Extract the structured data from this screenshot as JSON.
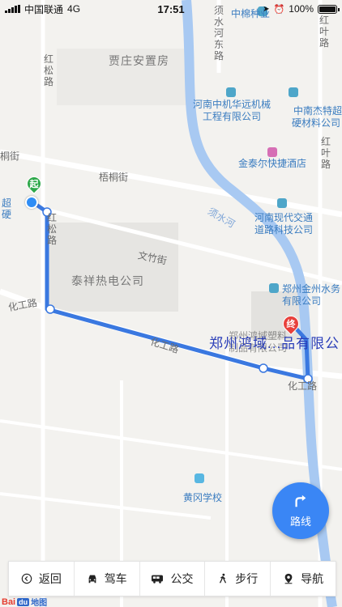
{
  "status_bar": {
    "carrier": "中国联通",
    "network": "4G",
    "time": "17:51",
    "battery": "100%"
  },
  "map": {
    "labels": {
      "zhongmian": "中棉种业",
      "xushui_east_road": "须水河东路",
      "hongye_road_top": "红叶路",
      "hongsong_road": "红松路",
      "jiazhuang": "贾庄安置房",
      "zhongji_huayuan": "河南中机华远机械工程有限公司",
      "zhongji_line1": "河南中机华远机械",
      "zhongji_line2": "工程有限公司",
      "jiete_line1": "中南杰特超",
      "jiete_line2": "硬材料公司",
      "hongye_road_mid": "红叶路",
      "jintaier": "金泰尔快捷酒店",
      "tonggu_street_left": "桐街",
      "wutong_street": "梧桐街",
      "chaoying_left1": "超",
      "chaoying_left2": "硬",
      "hongsong_road2": "红松路",
      "xushui_river": "须水河",
      "henan_xiandai_line1": "河南现代交通",
      "henan_xiandai_line2": "道路科技公司",
      "wenzhu_street": "文竹街",
      "taixiang": "泰祥热电公司",
      "zhengzhou_shuiwu_line1": "郑州金州水务",
      "zhengzhou_shuiwu_line2": "有限公司",
      "huagong_road_left": "化工路",
      "huagong_road_mid": "化工路",
      "huagong_road_right": "化工路",
      "destination_line1": "郑州鸿域塑料",
      "destination_line2": "制品有限公司",
      "huanggang_school": "黄冈学校"
    },
    "start_marker": "起",
    "end_marker": "终",
    "destination_title": "郑州鸿域...品有限公"
  },
  "route_button": {
    "label": "路线",
    "icon": "turn-right-arrow-icon"
  },
  "bottom_tabs": [
    {
      "label": "返回",
      "icon": "back-arrow-icon"
    },
    {
      "label": "驾车",
      "icon": "car-icon"
    },
    {
      "label": "公交",
      "icon": "bus-icon"
    },
    {
      "label": "步行",
      "icon": "walk-icon"
    },
    {
      "label": "导航",
      "icon": "navigation-pin-icon"
    }
  ],
  "logo": {
    "text_bai": "Bai",
    "text_du": "du",
    "text_map": "地图"
  },
  "colors": {
    "route": "#3a78e0",
    "map_bg": "#f3f2ef",
    "road": "#ffffff",
    "river": "#a8c9f2",
    "start_marker": "#2ea84a",
    "end_marker": "#e8403b",
    "route_button": "#3a86f5"
  }
}
